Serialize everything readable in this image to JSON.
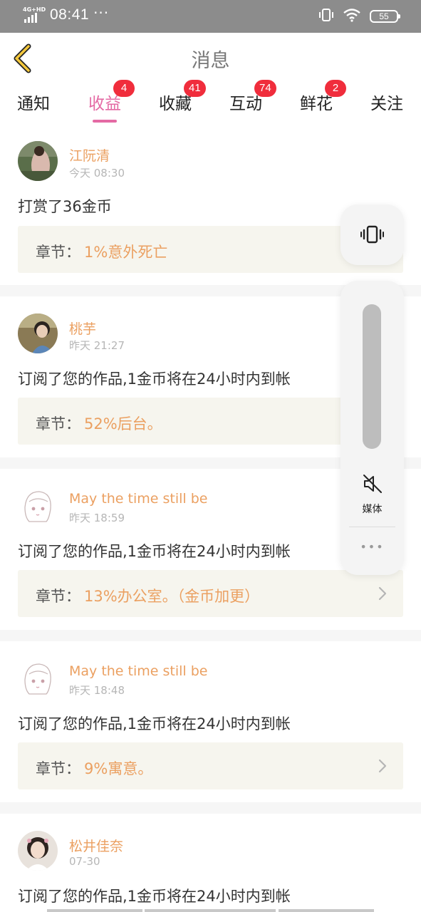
{
  "status_bar": {
    "network": "4G+HD",
    "time": "08:41",
    "dots": "···",
    "battery": "55",
    "icons": [
      "signal-icon",
      "vibrate-icon",
      "wifi-icon",
      "battery-icon"
    ]
  },
  "header": {
    "title": "消息",
    "back_icon": "chevron-left-icon"
  },
  "tabs": [
    {
      "label": "通知",
      "badge": ""
    },
    {
      "label": "收益",
      "badge": "4"
    },
    {
      "label": "收藏",
      "badge": "41"
    },
    {
      "label": "互动",
      "badge": "74"
    },
    {
      "label": "鲜花",
      "badge": "2"
    },
    {
      "label": "关注",
      "badge": ""
    }
  ],
  "messages": [
    {
      "name": "江阮清",
      "time": "今天 08:30",
      "text": "打赏了36金币",
      "chapter_label": "章节：",
      "chapter": "1%意外死亡"
    },
    {
      "name": "桃芋",
      "time": "昨天 21:27",
      "text": "订阅了您的作品,1金币将在24小时内到帐",
      "chapter_label": "章节：",
      "chapter": "52%后台。"
    },
    {
      "name": "May the time still be",
      "time": "昨天 18:59",
      "text": "订阅了您的作品,1金币将在24小时内到帐",
      "chapter_label": "章节：",
      "chapter": "13%办公室。（金币加更）"
    },
    {
      "name": "May the time still be",
      "time": "昨天 18:48",
      "text": "订阅了您的作品,1金币将在24小时内到帐",
      "chapter_label": "章节：",
      "chapter": "9%寓意。"
    },
    {
      "name": "松井佳奈",
      "time": "07-30",
      "text": "订阅了您的作品,1金币将在24小时内到帐"
    }
  ],
  "volume_panel": {
    "media_label": "媒体",
    "more": "•••",
    "icons": [
      "vibrate-mode-icon",
      "mute-speaker-icon",
      "more-dots-icon"
    ]
  },
  "colors": {
    "accent_pink": "#e46aa4",
    "name_orange": "#eba061",
    "badge_red": "#f02d3c",
    "chapter_bg": "#f6f5ee"
  }
}
